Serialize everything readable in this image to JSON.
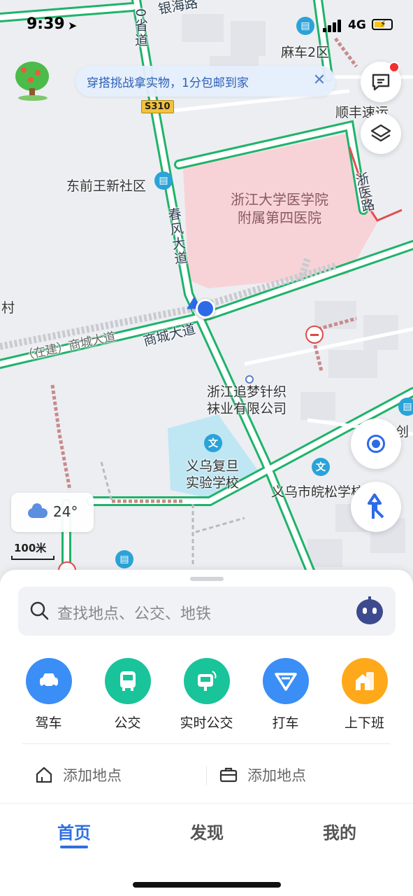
{
  "status_bar": {
    "time": "9:39",
    "network": "4G"
  },
  "banner": {
    "text": "穿搭挑战拿实物，1分包邮到家"
  },
  "map": {
    "labels": {
      "yinhai_road": "银海路",
      "sheng_dao": "0省道",
      "s310": "S310",
      "mache_2qu": "麻车2区",
      "shunfeng": "顺丰速运",
      "dongqianwang": "东前王新社区",
      "hospital_line1": "浙江大学医学院",
      "hospital_line2": "附属第四医院",
      "zheyi_road": "浙医路",
      "chunfeng": "春风大道",
      "village": "村",
      "shangcheng": "商城大道",
      "shangcheng_build": "（在建）商城大道",
      "knit_line1": "浙江追梦针织",
      "knit_line2": "袜业有限公司",
      "school_line1": "义乌复旦",
      "school_line2": "实验学校",
      "wansong": "义乌市皖松学校",
      "chuang": "创"
    }
  },
  "weather": {
    "temp": "24°",
    "icon": "cloud-icon"
  },
  "scale": {
    "label": "100米"
  },
  "search": {
    "placeholder": "查找地点、公交、地铁"
  },
  "quick_actions": [
    {
      "label": "驾车",
      "color": "#3a8ef6",
      "icon": "car-icon"
    },
    {
      "label": "公交",
      "color": "#19c49a",
      "icon": "bus-icon"
    },
    {
      "label": "实时公交",
      "color": "#19c49a",
      "icon": "realtime-bus-icon"
    },
    {
      "label": "打车",
      "color": "#3a8ef6",
      "icon": "taxi-icon"
    },
    {
      "label": "上下班",
      "color": "#ffa81a",
      "icon": "commute-icon"
    }
  ],
  "places": {
    "home": "添加地点",
    "work": "添加地点"
  },
  "tabs": [
    {
      "label": "首页"
    },
    {
      "label": "发现"
    },
    {
      "label": "我的"
    }
  ]
}
